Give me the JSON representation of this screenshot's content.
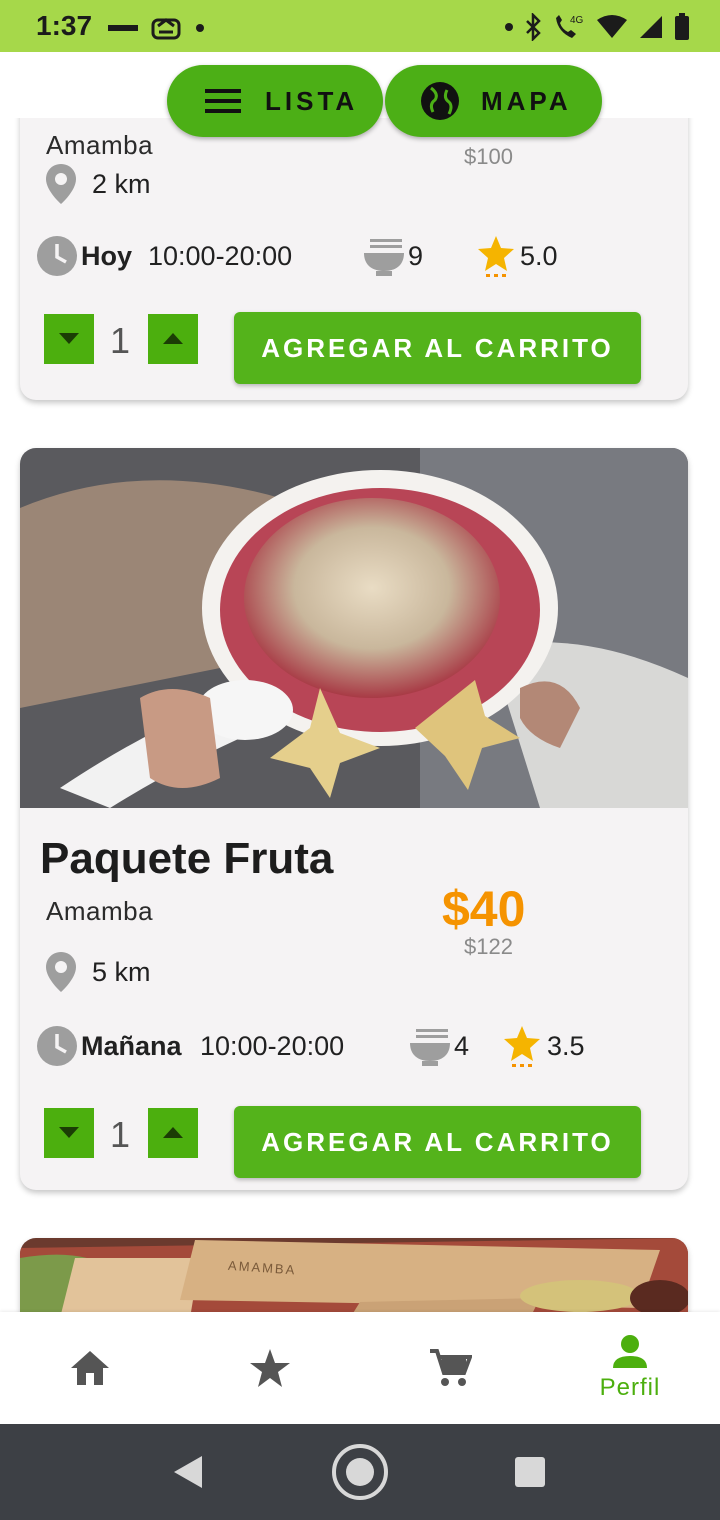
{
  "status_bar": {
    "time": "1:37",
    "network": "4G"
  },
  "toggle": {
    "list_label": "LISTA",
    "map_label": "MAPA"
  },
  "offers": [
    {
      "title": "",
      "shop": "Amamba",
      "price": "",
      "old_price": "$100",
      "distance": "2 km",
      "day": "Hoy",
      "hours": "10:00-20:00",
      "portions": "9",
      "rating": "5.0",
      "quantity": "1",
      "cart_label": "AGREGAR AL CARRITO"
    },
    {
      "title": "Paquete Fruta",
      "shop": "Amamba",
      "price": "$40",
      "old_price": "$122",
      "distance": "5 km",
      "day": "Mañana",
      "hours": "10:00-20:00",
      "portions": "4",
      "rating": "3.5",
      "quantity": "1",
      "cart_label": "AGREGAR AL CARRITO"
    },
    {
      "brand_text": "AMAMBA"
    }
  ],
  "bottom_nav": {
    "items": [
      {
        "icon": "home-icon",
        "label": ""
      },
      {
        "icon": "star-icon",
        "label": ""
      },
      {
        "icon": "cart-icon",
        "label": ""
      },
      {
        "icon": "person-icon",
        "label": "Perfil",
        "active": true
      }
    ]
  },
  "colors": {
    "status_bar": "#a6d84a",
    "primary_green": "#54b31b",
    "price_orange": "#f59300",
    "star_yellow": "#f5b400",
    "nav_active": "#4caf0e"
  }
}
